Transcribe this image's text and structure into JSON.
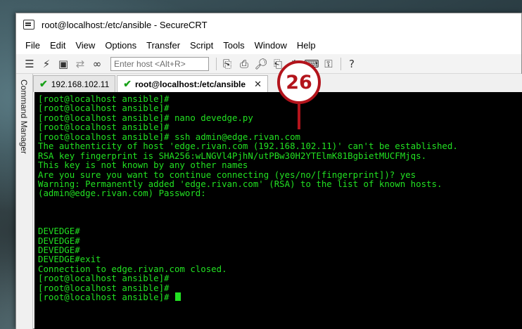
{
  "window": {
    "title": "root@localhost:/etc/ansible - SecureCRT"
  },
  "menu": [
    "File",
    "Edit",
    "View",
    "Options",
    "Transfer",
    "Script",
    "Tools",
    "Window",
    "Help"
  ],
  "toolbar": {
    "host_placeholder": "Enter host <Alt+R>",
    "icons": [
      "connect-bar-icon",
      "lightning-icon",
      "prompt-icon",
      "reconnect-icon",
      "link-icon",
      "copy-icon",
      "paste-icon",
      "find-icon",
      "print-icon",
      "settings-icon",
      "keymap-icon",
      "key-icon",
      "help-icon"
    ]
  },
  "tabs": [
    {
      "label": "192.168.102.11",
      "active": false
    },
    {
      "label": "root@localhost:/etc/ansible",
      "active": true
    }
  ],
  "side_panel": {
    "label": "Command Manager"
  },
  "terminal": {
    "lines": [
      "[root@localhost ansible]#",
      "[root@localhost ansible]#",
      "[root@localhost ansible]# nano devedge.py",
      "[root@localhost ansible]#",
      "[root@localhost ansible]# ssh admin@edge.rivan.com",
      "The authenticity of host 'edge.rivan.com (192.168.102.11)' can't be established.",
      "RSA key fingerprint is SHA256:wLNGVl4PjhN/utPBw30H2YTElmK81BgbietMUCFMjqs.",
      "This key is not known by any other names",
      "Are you sure you want to continue connecting (yes/no/[fingerprint])? yes",
      "Warning: Permanently added 'edge.rivan.com' (RSA) to the list of known hosts.",
      "(admin@edge.rivan.com) Password:",
      "",
      "",
      "",
      "DEVEDGE#",
      "DEVEDGE#",
      "DEVEDGE#",
      "DEVEDGE#exit",
      "Connection to edge.rivan.com closed.",
      "[root@localhost ansible]#",
      "[root@localhost ansible]#",
      "[root@localhost ansible]# "
    ]
  },
  "callout": {
    "number": "26",
    "color": "#b3141c"
  },
  "colors": {
    "terminal_bg": "#000000",
    "terminal_fg": "#22e022"
  }
}
